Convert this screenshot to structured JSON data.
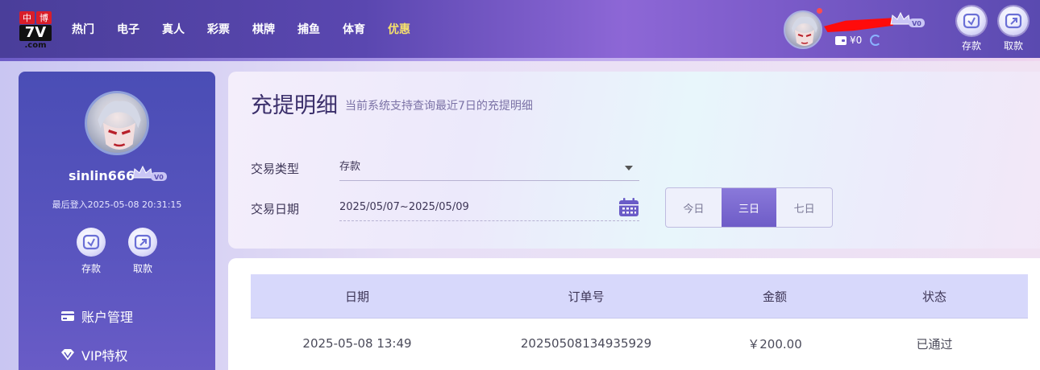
{
  "logo": {
    "cn_left": "中",
    "cn_right": "博",
    "number": "7V",
    "domain": ".com"
  },
  "nav": {
    "items": [
      {
        "label": "热门"
      },
      {
        "label": "电子"
      },
      {
        "label": "真人"
      },
      {
        "label": "彩票"
      },
      {
        "label": "棋牌"
      },
      {
        "label": "捕鱼"
      },
      {
        "label": "体育"
      },
      {
        "label": "优惠"
      }
    ],
    "highlight_color": "#f7e26b"
  },
  "header": {
    "vip_level": "V0",
    "balance": "¥0",
    "deposit_label": "存款",
    "withdraw_label": "取款"
  },
  "sidebar": {
    "username": "sinlin666",
    "vip_level": "V0",
    "last_login": "最后登入2025-05-08 20:31:15",
    "deposit_label": "存款",
    "withdraw_label": "取款",
    "menu": [
      {
        "label": "账户管理",
        "icon": "card-icon"
      },
      {
        "label": "VIP特权",
        "icon": "diamond-icon"
      }
    ]
  },
  "filter": {
    "title": "充提明细",
    "subtitle": "当前系统支持查询最近7日的充提明细",
    "type_label": "交易类型",
    "type_value": "存款",
    "date_label": "交易日期",
    "date_value": "2025/05/07~2025/05/09",
    "ranges": [
      {
        "label": "今日",
        "active": false
      },
      {
        "label": "三日",
        "active": true
      },
      {
        "label": "七日",
        "active": false
      }
    ]
  },
  "table": {
    "headers": [
      "日期",
      "订单号",
      "金额",
      "状态"
    ],
    "rows": [
      [
        "2025-05-08 13:49",
        "20250508134935929",
        "￥200.00",
        "已通过"
      ]
    ]
  },
  "colors": {
    "accent": "#6e5cc7",
    "sidebar": "#4a4db5",
    "table_header": "#d7d8fb"
  }
}
